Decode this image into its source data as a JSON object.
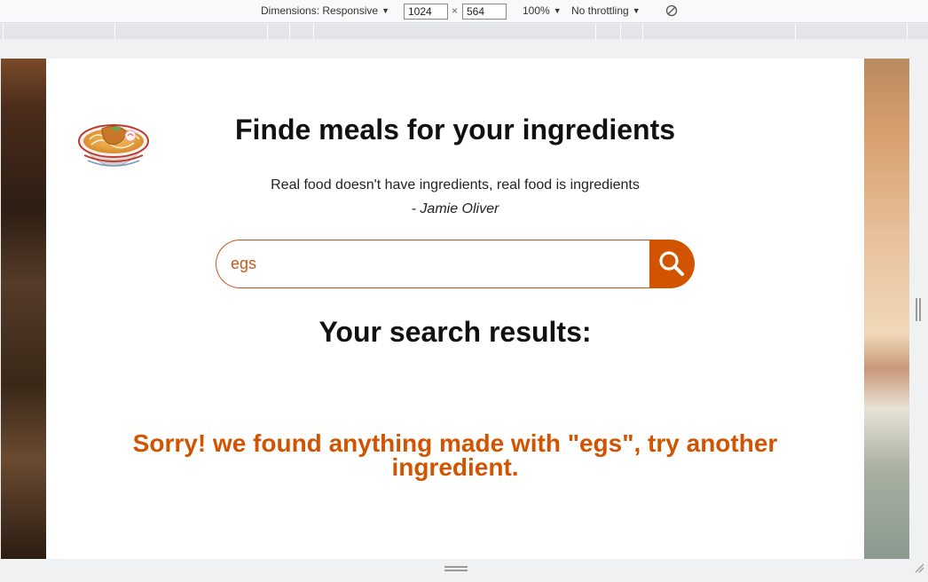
{
  "devtools": {
    "dimensions_label": "Dimensions: Responsive",
    "width_value": "1024",
    "times": "×",
    "height_value": "564",
    "zoom": "100%",
    "throttling": "No throttling"
  },
  "page": {
    "title": "Finde meals for your ingredients",
    "quote": "Real food doesn't have ingredients, real food is ingredients",
    "quote_author": "- Jamie Oliver",
    "search": {
      "value": "egs",
      "button_icon": "search-icon"
    },
    "results_heading": "Your search results:",
    "no_results_message": "Sorry! we found anything made with \"egs\", try another ingredient."
  },
  "colors": {
    "accent": "#d35400",
    "text": "#111111"
  }
}
